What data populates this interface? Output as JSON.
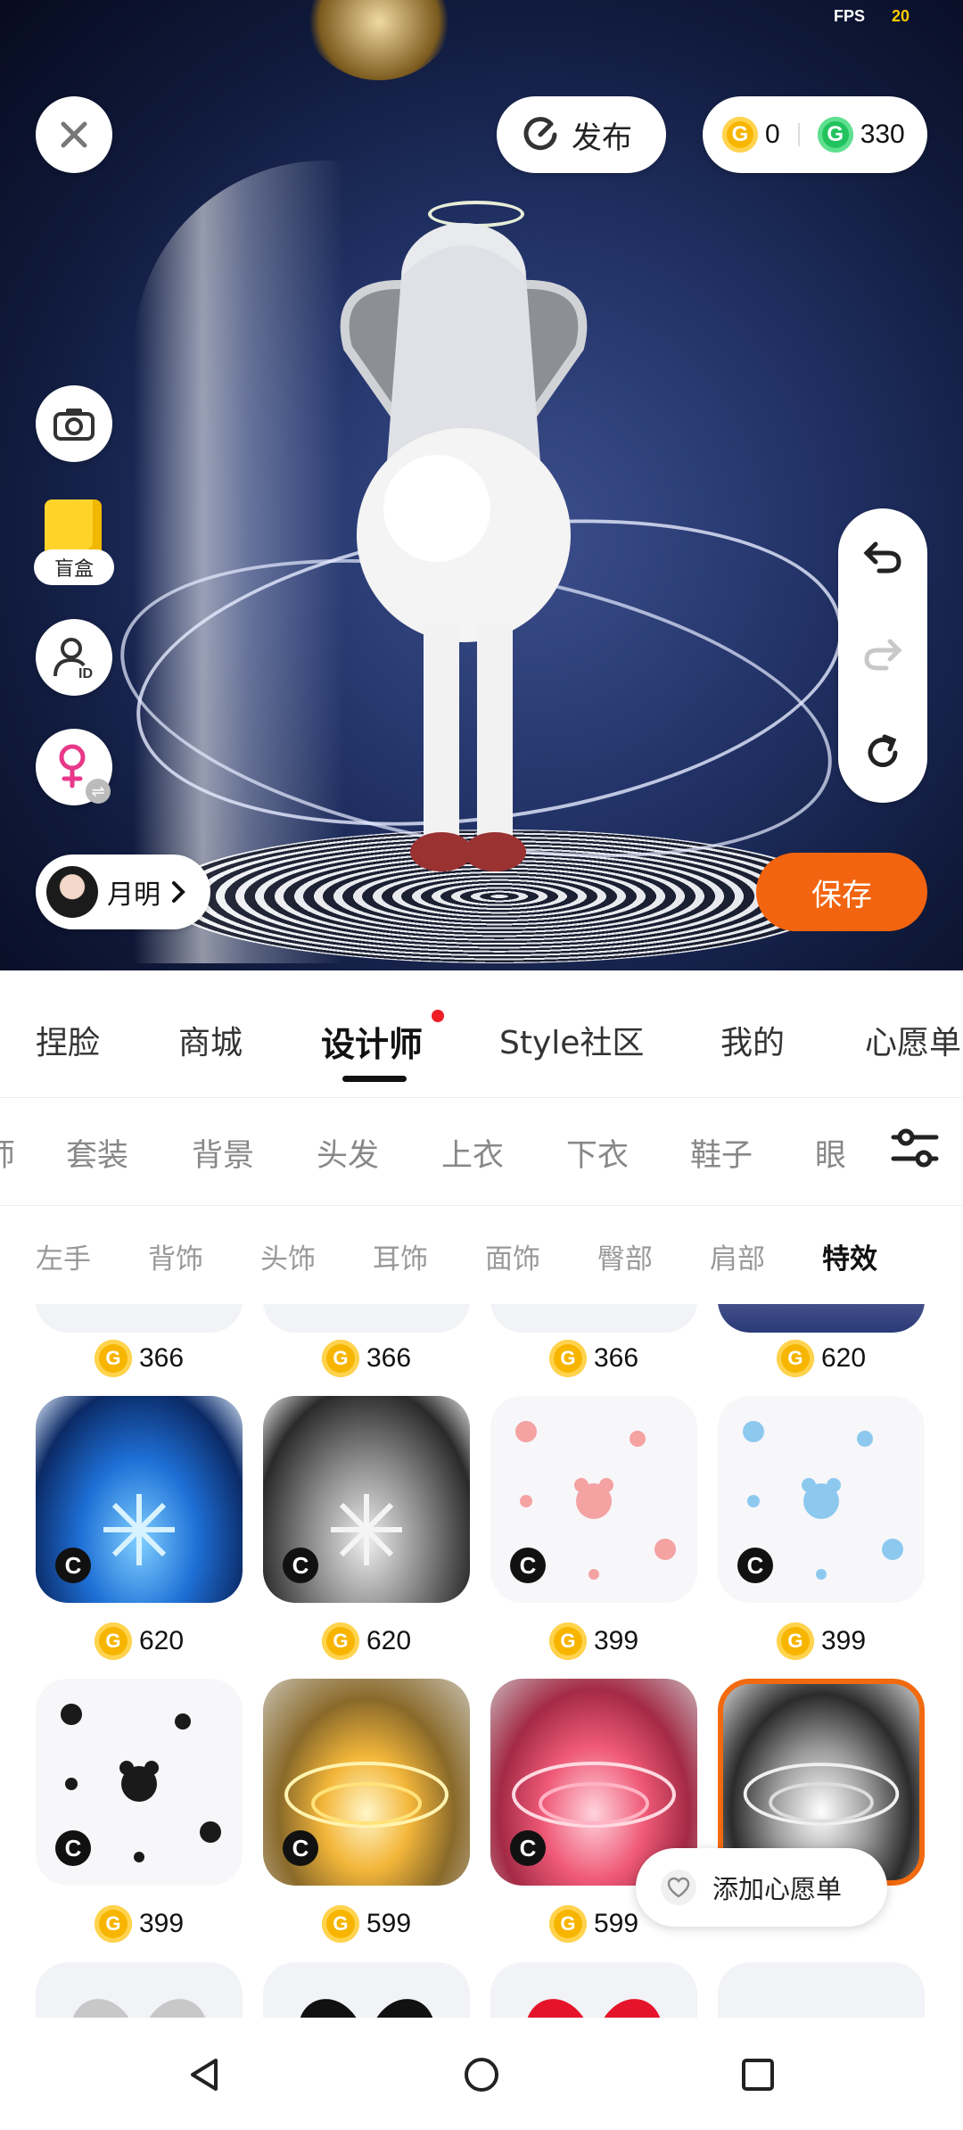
{
  "status": {
    "fps_label": "FPS",
    "fps_value": "20"
  },
  "header": {
    "publish_label": "发布",
    "gold_coins": "0",
    "green_coins": "330",
    "coin_symbol": "G"
  },
  "side_tools": {
    "blindbox_label": "盲盒"
  },
  "profile": {
    "username": "月明"
  },
  "actions": {
    "save_label": "保存"
  },
  "main_tabs": [
    {
      "label": "捏脸"
    },
    {
      "label": "商城"
    },
    {
      "label": "设计师"
    },
    {
      "label": "Style社区"
    },
    {
      "label": "我的"
    },
    {
      "label": "心愿单"
    }
  ],
  "category_tabs": [
    {
      "label": "师"
    },
    {
      "label": "套装"
    },
    {
      "label": "背景"
    },
    {
      "label": "头发"
    },
    {
      "label": "上衣"
    },
    {
      "label": "下衣"
    },
    {
      "label": "鞋子"
    },
    {
      "label": "眼"
    }
  ],
  "sub_tabs": [
    {
      "label": "左手"
    },
    {
      "label": "背饰"
    },
    {
      "label": "头饰"
    },
    {
      "label": "耳饰"
    },
    {
      "label": "面饰"
    },
    {
      "label": "臀部"
    },
    {
      "label": "肩部"
    },
    {
      "label": "特效"
    }
  ],
  "items": [
    {
      "price": "366"
    },
    {
      "price": "366"
    },
    {
      "price": "366"
    },
    {
      "price": "620"
    },
    {
      "price": "620"
    },
    {
      "price": "620"
    },
    {
      "price": "399"
    },
    {
      "price": "399"
    },
    {
      "price": "399"
    },
    {
      "price": "599"
    },
    {
      "price": "599"
    },
    {
      "price": ""
    }
  ],
  "creator_badge": "C",
  "wishlist": {
    "label": "添加心愿单"
  },
  "icons": {
    "close": "close-icon",
    "publish": "refresh-c-icon",
    "camera": "camera-icon",
    "blindbox": "gift-box-icon",
    "avatar_id": "person-id-icon",
    "gender": "female-icon",
    "undo": "undo-icon",
    "redo": "redo-icon",
    "reset": "reset-icon",
    "filter": "filter-sliders-icon",
    "heart": "heart-icon",
    "back": "back-triangle-icon",
    "home": "home-circle-icon",
    "recents": "recents-square-icon"
  },
  "colors": {
    "accent": "#f2640f",
    "gold": "#f7b500",
    "green": "#22c35e",
    "badge_dot": "#ee1c25"
  }
}
